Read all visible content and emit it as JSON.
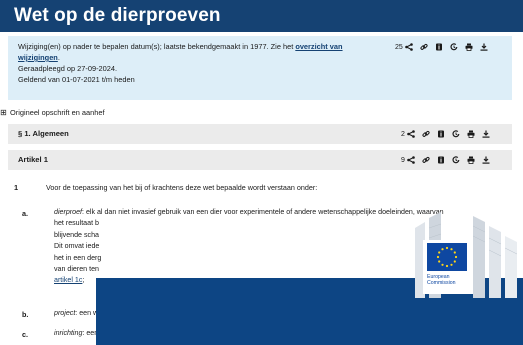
{
  "title": "Wet op de dierproeven",
  "info": {
    "line1_prefix": "Wijziging(en) op nader te bepalen datum(s); laatste bekendgemaakt in 1977. Zie het ",
    "link_text": "overzicht van",
    "link_text_2": "wijzigingen",
    "line2_suffix": ".",
    "consulted": "Geraadpleegd op 27-09-2024.",
    "valid": "Geldend van 01-07-2021 t/m heden"
  },
  "toolbars": [
    {
      "count": "25"
    },
    {
      "count": "2"
    },
    {
      "count": "9"
    }
  ],
  "origin_toggle": {
    "symbol": "⊞",
    "label": "Origineel opschrift en aanhef"
  },
  "sections": [
    {
      "label": "§ 1. Algemeen"
    },
    {
      "label": "Artikel 1"
    }
  ],
  "paragraph": {
    "number": "1",
    "text": "Voor de toepassing van het bij of krachtens deze wet bepaalde wordt verstaan onder:"
  },
  "definitions": [
    {
      "letter": "a.",
      "term": "dierproef",
      "line1_rest": ": elk al dan niet invasief gebruik van een dier voor experimentele of andere wetenschappelijke doeleinden, waarvan",
      "line2": "het resultaat b",
      "line3": "blijvende scha",
      "line4": "Dit omvat iede",
      "line5": "het in een derg",
      "line6": "van dieren ten",
      "link": "artikel 1c",
      "link_suffix": ";"
    },
    {
      "letter": "b.",
      "term": "project",
      "rest": ": een we"
    },
    {
      "letter": "c.",
      "term": "inrichting",
      "rest": ": een i"
    }
  ],
  "ec_logo": {
    "line1": "European",
    "line2": "Commission"
  },
  "colors": {
    "header": "#154273",
    "info_bg": "#ddeef8",
    "section_bg": "#ebebeb",
    "ec_blue": "#0d4584",
    "eu_flag": "#0e47a1",
    "eu_star": "#ffd617"
  },
  "icons": [
    "share-icon",
    "link-icon",
    "info-icon",
    "history-icon",
    "print-icon",
    "download-icon"
  ]
}
